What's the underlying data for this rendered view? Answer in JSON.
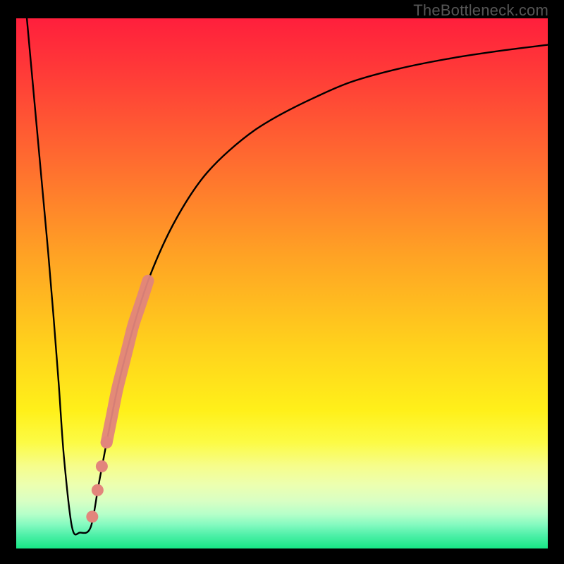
{
  "watermark": "TheBottleneck.com",
  "colors": {
    "frame": "#000000",
    "curve": "#000000",
    "marker_fill": "#e2857c",
    "marker_stroke": "#c86b64",
    "gradient_stops": [
      {
        "offset": 0.0,
        "color": "#ff1f3c"
      },
      {
        "offset": 0.1,
        "color": "#ff3a38"
      },
      {
        "offset": 0.28,
        "color": "#ff6f2f"
      },
      {
        "offset": 0.45,
        "color": "#ffa324"
      },
      {
        "offset": 0.62,
        "color": "#ffd21c"
      },
      {
        "offset": 0.74,
        "color": "#fff01a"
      },
      {
        "offset": 0.8,
        "color": "#fcfb45"
      },
      {
        "offset": 0.845,
        "color": "#f6fd8c"
      },
      {
        "offset": 0.88,
        "color": "#ecffb0"
      },
      {
        "offset": 0.91,
        "color": "#d9ffc3"
      },
      {
        "offset": 0.935,
        "color": "#b6ffc9"
      },
      {
        "offset": 0.955,
        "color": "#84fac0"
      },
      {
        "offset": 0.975,
        "color": "#4ef0a8"
      },
      {
        "offset": 1.0,
        "color": "#17e786"
      }
    ]
  },
  "chart_data": {
    "type": "line",
    "title": "",
    "xlabel": "",
    "ylabel": "",
    "xlim": [
      0,
      100
    ],
    "ylim": [
      0,
      100
    ],
    "grid": false,
    "series": [
      {
        "name": "bottleneck-curve",
        "x": [
          2,
          3,
          4,
          5,
          6,
          7,
          8,
          9,
          10.5,
          12,
          14,
          15.5,
          17,
          19,
          21,
          23,
          25,
          27.5,
          30,
          33,
          36,
          40,
          45,
          50,
          56,
          63,
          72,
          82,
          92,
          100
        ],
        "y": [
          100,
          89,
          78,
          67,
          56,
          44,
          31,
          17,
          4,
          3,
          4,
          12,
          20,
          30,
          38,
          45,
          51,
          57,
          62,
          67,
          71,
          75,
          79,
          82,
          85,
          88,
          90.5,
          92.5,
          94,
          95
        ]
      }
    ],
    "annotations": {
      "highlight_segment": {
        "name": "highlighted-range",
        "x": [
          17,
          18,
          19,
          20,
          21,
          22,
          23,
          24,
          24.8
        ],
        "y": [
          20,
          25,
          30,
          34,
          38,
          42,
          45,
          48,
          50.5
        ]
      },
      "dots": [
        {
          "x": 14.3,
          "y": 6
        },
        {
          "x": 15.3,
          "y": 11
        },
        {
          "x": 16.1,
          "y": 15.5
        },
        {
          "x": 17.0,
          "y": 20
        }
      ]
    }
  }
}
